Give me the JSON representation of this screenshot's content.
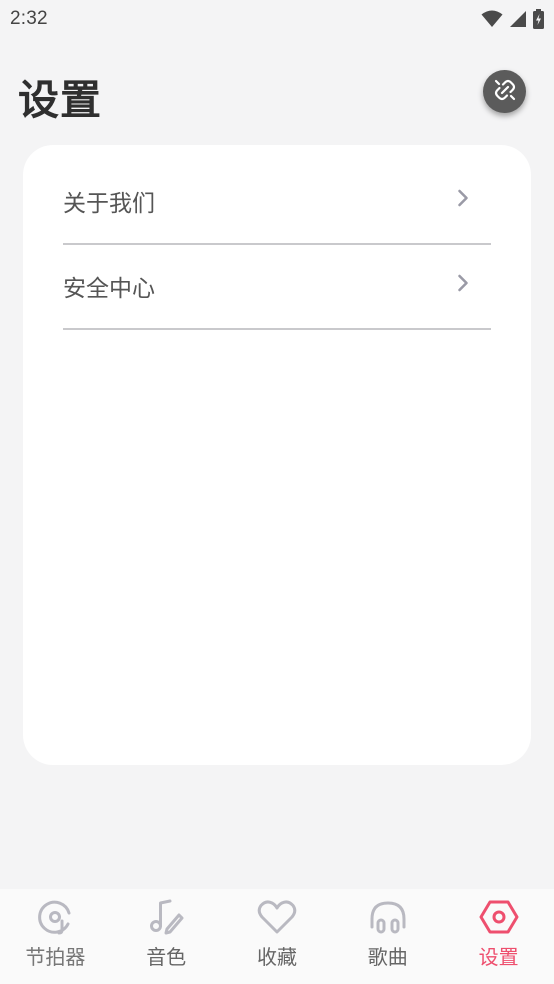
{
  "status_bar": {
    "time": "2:32",
    "icons": [
      "wifi-icon",
      "signal-icon",
      "battery-charging-icon"
    ]
  },
  "header": {
    "title": "设置",
    "action_icon": "unlink-icon"
  },
  "settings_list": [
    {
      "label": "关于我们",
      "icon": "chevron-right-icon"
    },
    {
      "label": "安全中心",
      "icon": "chevron-right-icon"
    }
  ],
  "tab_bar": {
    "items": [
      {
        "label": "节拍器",
        "icon": "metronome-disc-icon",
        "active": false
      },
      {
        "label": "音色",
        "icon": "music-note-edit-icon",
        "active": false
      },
      {
        "label": "收藏",
        "icon": "heart-icon",
        "active": false
      },
      {
        "label": "歌曲",
        "icon": "headphones-icon",
        "active": false
      },
      {
        "label": "设置",
        "icon": "settings-hexagon-icon",
        "active": true
      }
    ]
  },
  "colors": {
    "background": "#f4f4f5",
    "card": "#ffffff",
    "accent": "#ee4f6e",
    "icon_inactive": "#b9b9c1"
  }
}
